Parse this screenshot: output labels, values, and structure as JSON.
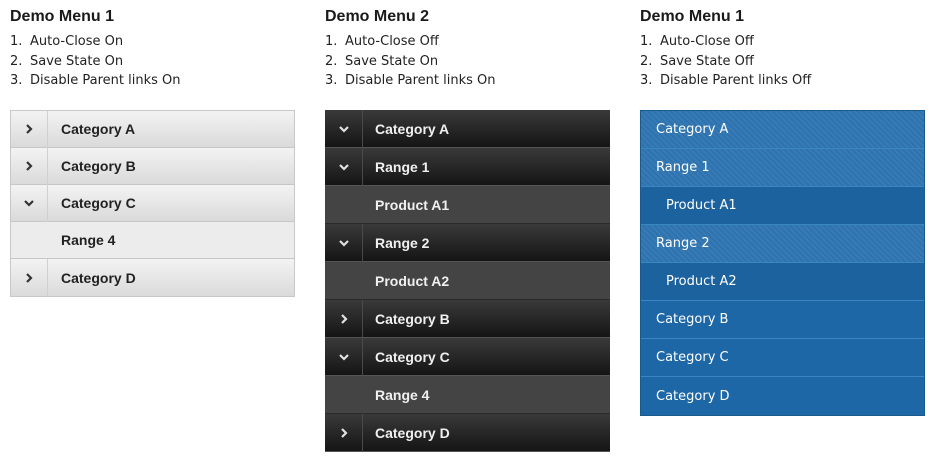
{
  "menus": [
    {
      "title": "Demo Menu 1",
      "features": [
        "Auto-Close On",
        "Save State On",
        "Disable Parent links On"
      ],
      "items": [
        {
          "label": "Category A",
          "icon": "chevron-right-icon"
        },
        {
          "label": "Category B",
          "icon": "chevron-right-icon"
        },
        {
          "label": "Category C",
          "icon": "chevron-down-icon"
        },
        {
          "label": "Range 4",
          "icon": ""
        },
        {
          "label": "Category D",
          "icon": "chevron-right-icon"
        }
      ]
    },
    {
      "title": "Demo Menu 2",
      "features": [
        "Auto-Close Off",
        "Save State On",
        "Disable Parent links On"
      ],
      "items": [
        {
          "label": "Category A",
          "icon": "chevron-down-icon"
        },
        {
          "label": "Range 1",
          "icon": "chevron-down-icon"
        },
        {
          "label": "Product A1",
          "icon": ""
        },
        {
          "label": "Range 2",
          "icon": "chevron-down-icon"
        },
        {
          "label": "Product A2",
          "icon": ""
        },
        {
          "label": "Category B",
          "icon": "chevron-right-icon"
        },
        {
          "label": "Category C",
          "icon": "chevron-down-icon"
        },
        {
          "label": "Range 4",
          "icon": ""
        },
        {
          "label": "Category D",
          "icon": "chevron-right-icon"
        }
      ]
    },
    {
      "title": "Demo Menu 1",
      "features": [
        "Auto-Close Off",
        "Save State Off",
        "Disable Parent links Off"
      ],
      "items": [
        {
          "label": "Category A"
        },
        {
          "label": "Range 1"
        },
        {
          "label": "Product A1"
        },
        {
          "label": "Range 2"
        },
        {
          "label": "Product A2"
        },
        {
          "label": "Category B"
        },
        {
          "label": "Category C"
        },
        {
          "label": "Category D"
        }
      ]
    }
  ],
  "list_numbers": [
    "1.",
    "2.",
    "3."
  ],
  "colors": {
    "menu1_bg": "#e3e3e3",
    "menu2_bg": "#222222",
    "menu3_bg": "#1e67a6"
  }
}
